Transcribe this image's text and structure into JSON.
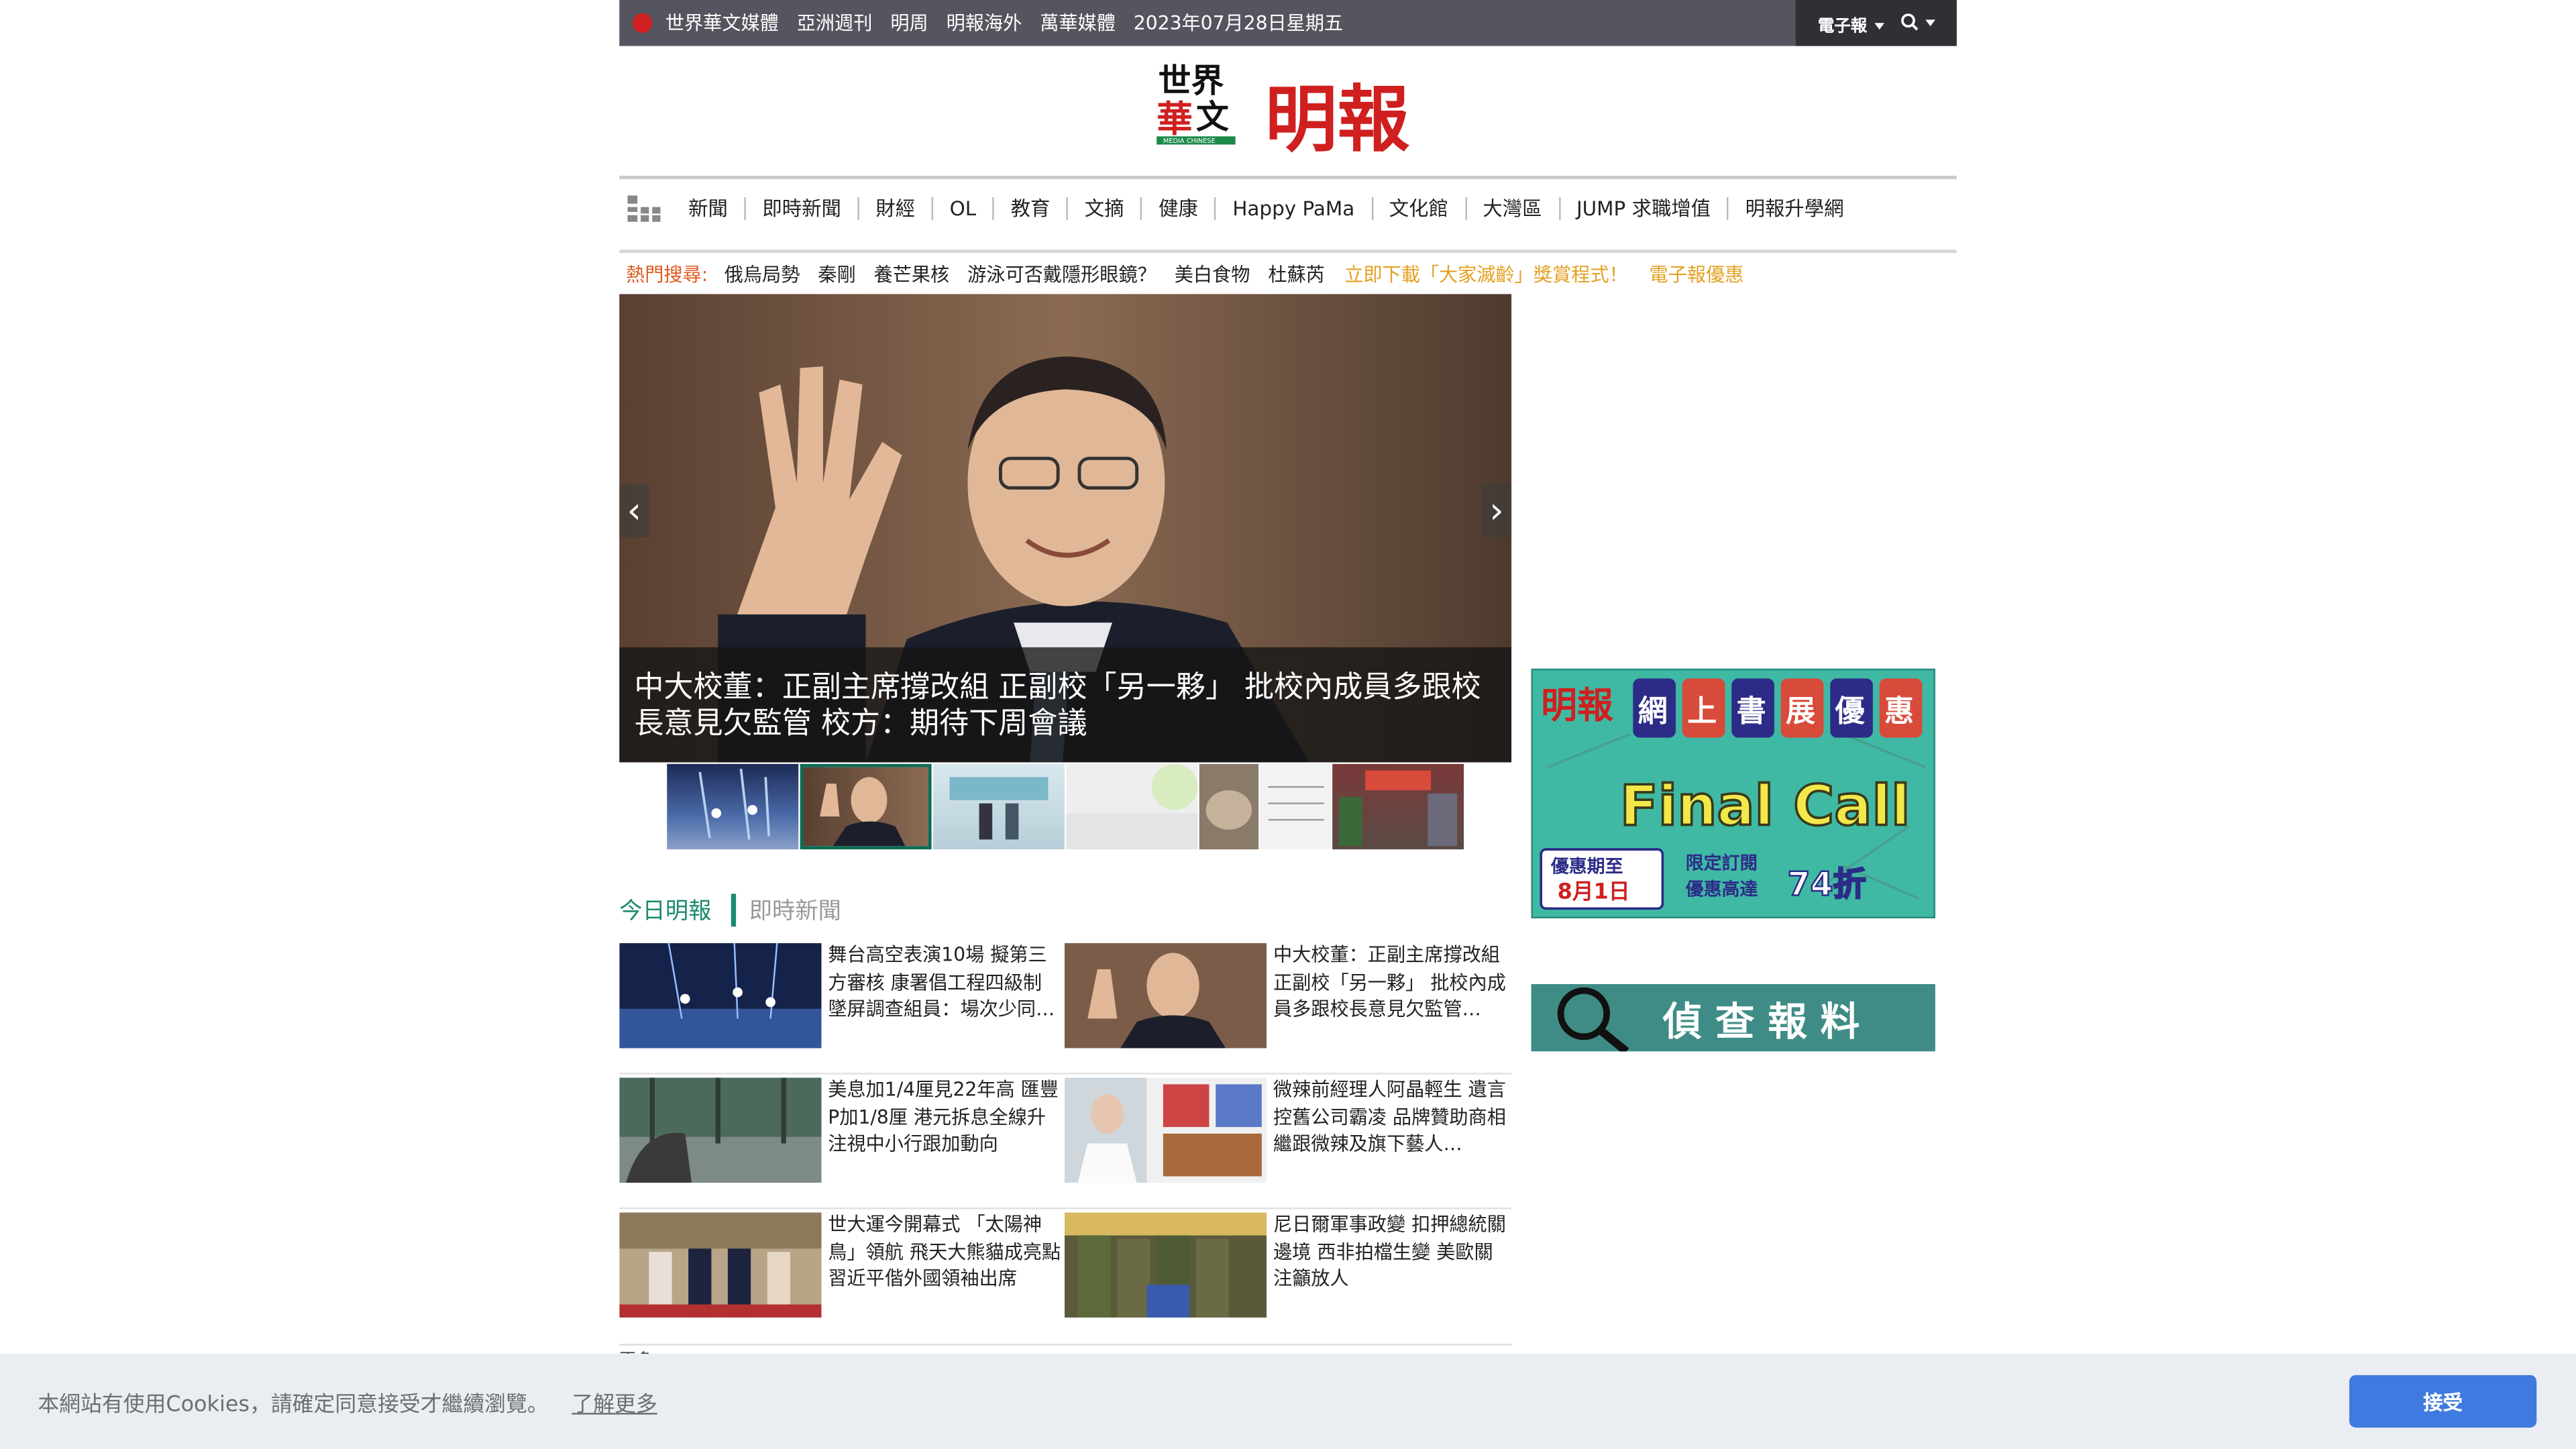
{
  "topbar": {
    "links": [
      "世界華文媒體",
      "亞洲週刊",
      "明周",
      "明報海外",
      "萬華媒體"
    ],
    "date": "2023年07月28日星期五",
    "epaper_label": "電子報"
  },
  "masthead": {
    "logo_chars": [
      "世界",
      "華",
      "文",
      "明報"
    ],
    "logo_small": "MEDIA CHINESE"
  },
  "nav": {
    "items": [
      "新聞",
      "即時新聞",
      "財經",
      "OL",
      "教育",
      "文摘",
      "健康",
      "Happy PaMa",
      "文化館",
      "大灣區",
      "JUMP 求職增值",
      "明報升學網"
    ]
  },
  "hot_search": {
    "label": "熱門搜尋:",
    "keywords": [
      "俄烏局勢",
      "秦剛",
      "養芒果核",
      "游泳可否戴隱形眼鏡？",
      "美白食物",
      "杜蘇芮"
    ],
    "promos": [
      "立即下載「大家滅齡」獎賞程式！",
      "電子報優惠"
    ]
  },
  "slider": {
    "caption": "中大校董：正副主席撐改組 正副校「另一夥」 批校內成員多跟校長意見欠監管 校方：期待下周會議",
    "thumb_count": 6,
    "active_thumb": 2
  },
  "section_tabs": {
    "today": "今日明報",
    "live": "即時新聞"
  },
  "news": [
    [
      "舞台高空表演10場 擬第三方審核 康署倡工程四級制 墜屏調查組員：場次少同…",
      "中大校董：正副主席撐改組 正副校「另一夥」 批校內成員多跟校長意見欠監管…"
    ],
    [
      "美息加1/4厘見22年高 匯豐P加1/8厘 港元拆息全線升 注視中小行跟加動向",
      "微辣前經理人阿晶輕生 遺言控舊公司霸凌 品牌贊助商相繼跟微辣及旗下藝人…"
    ],
    [
      "世大運今開幕式 「太陽神鳥」領航 飛天大熊貓成亮點 習近平偕外國領袖出席",
      "尼日爾軍事政變 扣押總統關邊境 西非拍檔生變 美歐關注籲放人"
    ]
  ],
  "more_label": "更多",
  "ads": {
    "bookfair": {
      "brand": "明報",
      "title_chars": [
        "網",
        "上",
        "書",
        "展",
        "優",
        "惠"
      ],
      "headline": "Final Call",
      "deadline_label": "優惠期至",
      "deadline": "8月1日",
      "offer_1": "限定訂閱",
      "offer_2": "優惠高達",
      "discount": "74折"
    },
    "report": {
      "text": "偵查報料"
    }
  },
  "cookie": {
    "message": "本網站有使用Cookies，請確定同意接受才繼續瀏覽。",
    "more": "了解更多",
    "accept": "接受"
  }
}
